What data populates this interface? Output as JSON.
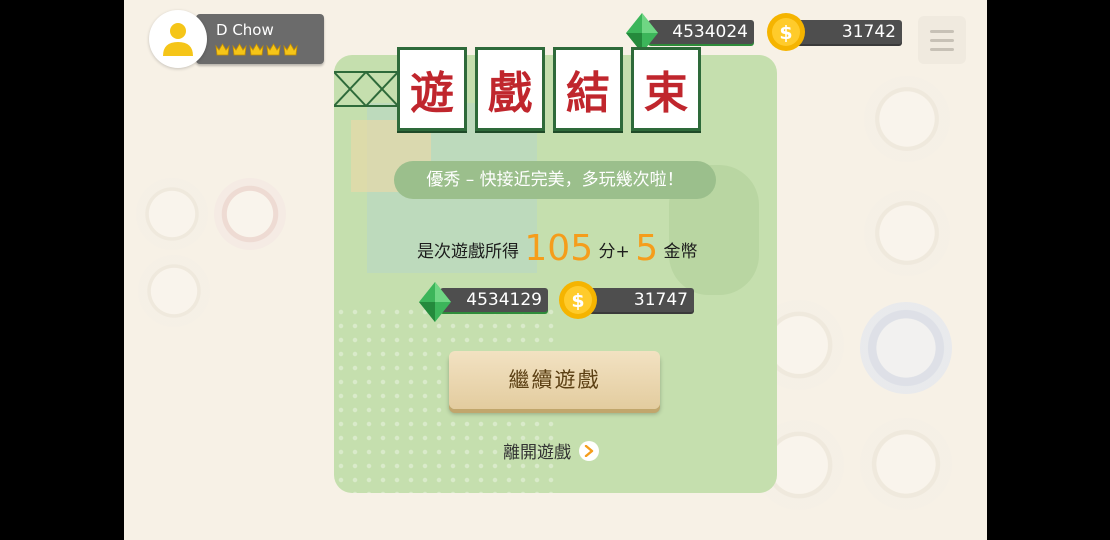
{
  "player": {
    "name": "D Chow",
    "crown_count": 5
  },
  "currencies": {
    "gems": "4534024",
    "coins": "31742"
  },
  "result": {
    "title_chars": [
      "遊",
      "戲",
      "結",
      "束"
    ],
    "rating_message": "優秀 – 快接近完美，多玩幾次啦！",
    "score_prefix": "是次遊戲所得",
    "score_value": "105",
    "score_unit": "分+",
    "coin_bonus": "5",
    "coin_unit": "金幣",
    "new_gems": "4534129",
    "new_coins": "31747",
    "continue_label": "繼續遊戲",
    "leave_label": "離開遊戲"
  },
  "colors": {
    "panel": "#c5dfae",
    "title_text": "#c0262d",
    "tile_border": "#2e6a3a",
    "score_highlight": "#f59d1b",
    "gem": "#3cb55a",
    "coin": "#f5b400"
  },
  "icons": {
    "avatar": "user-silhouette-icon",
    "rank": "crown-icon",
    "gem": "green-gem-icon",
    "coin": "dollar-coin-icon",
    "menu": "hamburger-menu-icon",
    "leave": "chevron-right-icon"
  }
}
